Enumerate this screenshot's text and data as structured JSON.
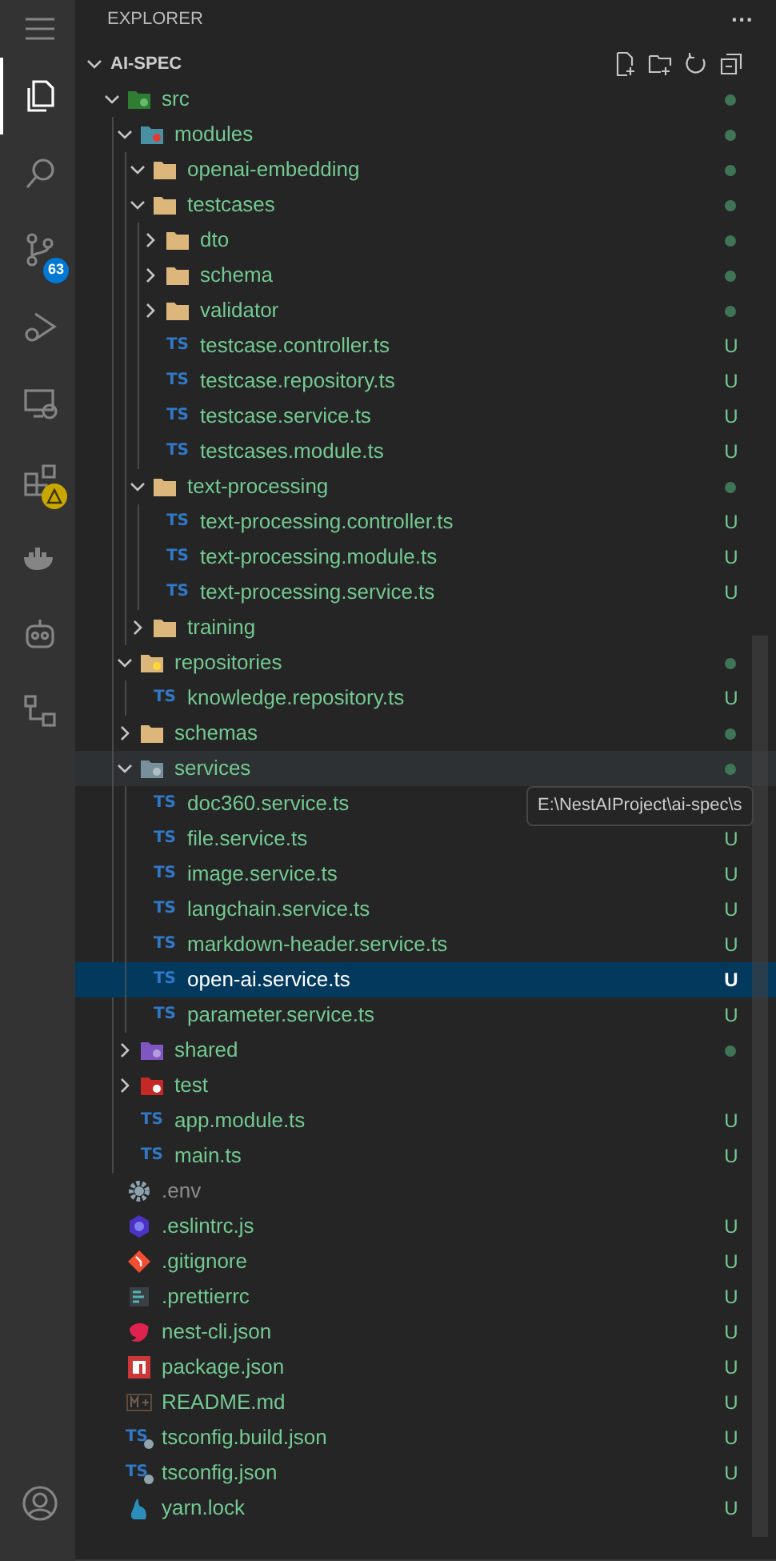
{
  "activity_bar": [
    {
      "kind": "menu",
      "selected": false
    },
    {
      "kind": "files",
      "selected": true
    },
    {
      "kind": "search",
      "selected": false
    },
    {
      "kind": "source-control",
      "selected": false,
      "badge": "63"
    },
    {
      "kind": "run-debug",
      "selected": false
    },
    {
      "kind": "remote",
      "selected": false
    },
    {
      "kind": "extensions",
      "selected": false,
      "warning": true
    },
    {
      "kind": "docker",
      "selected": false
    },
    {
      "kind": "robot",
      "selected": false
    },
    {
      "kind": "tree",
      "selected": false
    }
  ],
  "account": {
    "kind": "account"
  },
  "explorer": {
    "title": "EXPLORER",
    "more": "···",
    "section": {
      "title": "AI-SPEC",
      "expanded": true,
      "items": [
        {
          "name": "src",
          "kind": "folder-src",
          "expanded": true,
          "dot": true,
          "ignored": false,
          "selected": false,
          "hovered": false,
          "children": [
            {
              "name": "modules",
              "kind": "folder-modules",
              "expanded": true,
              "dot": true,
              "ignored": false,
              "selected": false,
              "hovered": false,
              "children": [
                {
                  "name": "openai-embedding",
                  "kind": "folder",
                  "expanded": true,
                  "dot": true,
                  "ignored": false,
                  "selected": false,
                  "hovered": false
                },
                {
                  "name": "testcases",
                  "kind": "folder",
                  "expanded": true,
                  "dot": true,
                  "ignored": false,
                  "selected": false,
                  "hovered": false,
                  "children": [
                    {
                      "name": "dto",
                      "kind": "folder",
                      "expanded": false,
                      "dot": true,
                      "ignored": false,
                      "selected": false,
                      "hovered": false
                    },
                    {
                      "name": "schema",
                      "kind": "folder",
                      "expanded": false,
                      "dot": true,
                      "ignored": false,
                      "selected": false,
                      "hovered": false
                    },
                    {
                      "name": "validator",
                      "kind": "folder",
                      "expanded": false,
                      "dot": true,
                      "ignored": false,
                      "selected": false,
                      "hovered": false
                    },
                    {
                      "name": "testcase.controller.ts",
                      "kind": "ts",
                      "icon_label": "TS",
                      "badge": "U",
                      "ignored": false,
                      "selected": false,
                      "hovered": false
                    },
                    {
                      "name": "testcase.repository.ts",
                      "kind": "ts",
                      "icon_label": "TS",
                      "badge": "U",
                      "ignored": false,
                      "selected": false,
                      "hovered": false
                    },
                    {
                      "name": "testcase.service.ts",
                      "kind": "ts",
                      "icon_label": "TS",
                      "badge": "U",
                      "ignored": false,
                      "selected": false,
                      "hovered": false
                    },
                    {
                      "name": "testcases.module.ts",
                      "kind": "ts",
                      "icon_label": "TS",
                      "badge": "U",
                      "ignored": false,
                      "selected": false,
                      "hovered": false
                    }
                  ]
                },
                {
                  "name": "text-processing",
                  "kind": "folder",
                  "expanded": true,
                  "dot": true,
                  "ignored": false,
                  "selected": false,
                  "hovered": false,
                  "children": [
                    {
                      "name": "text-processing.controller.ts",
                      "kind": "ts",
                      "icon_label": "TS",
                      "badge": "U",
                      "ignored": false,
                      "selected": false,
                      "hovered": false
                    },
                    {
                      "name": "text-processing.module.ts",
                      "kind": "ts",
                      "icon_label": "TS",
                      "badge": "U",
                      "ignored": false,
                      "selected": false,
                      "hovered": false
                    },
                    {
                      "name": "text-processing.service.ts",
                      "kind": "ts",
                      "icon_label": "TS",
                      "badge": "U",
                      "ignored": false,
                      "selected": false,
                      "hovered": false
                    }
                  ]
                },
                {
                  "name": "training",
                  "kind": "folder",
                  "expanded": false,
                  "dot": false,
                  "ignored": false,
                  "selected": false,
                  "hovered": false
                }
              ]
            },
            {
              "name": "repositories",
              "kind": "folder-repo",
              "expanded": true,
              "dot": true,
              "ignored": false,
              "selected": false,
              "hovered": false,
              "children": [
                {
                  "name": "knowledge.repository.ts",
                  "kind": "ts",
                  "icon_label": "TS",
                  "badge": "U",
                  "ignored": false,
                  "selected": false,
                  "hovered": false
                }
              ]
            },
            {
              "name": "schemas",
              "kind": "folder",
              "expanded": false,
              "dot": true,
              "ignored": false,
              "selected": false,
              "hovered": false
            },
            {
              "name": "services",
              "kind": "folder-services",
              "expanded": true,
              "dot": true,
              "ignored": false,
              "selected": false,
              "hovered": true,
              "children": [
                {
                  "name": "doc360.service.ts",
                  "kind": "ts",
                  "icon_label": "TS",
                  "ignored": false,
                  "selected": false,
                  "hovered": false
                },
                {
                  "name": "file.service.ts",
                  "kind": "ts",
                  "icon_label": "TS",
                  "badge": "U",
                  "ignored": false,
                  "selected": false,
                  "hovered": false
                },
                {
                  "name": "image.service.ts",
                  "kind": "ts",
                  "icon_label": "TS",
                  "badge": "U",
                  "ignored": false,
                  "selected": false,
                  "hovered": false
                },
                {
                  "name": "langchain.service.ts",
                  "kind": "ts",
                  "icon_label": "TS",
                  "badge": "U",
                  "ignored": false,
                  "selected": false,
                  "hovered": false
                },
                {
                  "name": "markdown-header.service.ts",
                  "kind": "ts",
                  "icon_label": "TS",
                  "badge": "U",
                  "ignored": false,
                  "selected": false,
                  "hovered": false
                },
                {
                  "name": "open-ai.service.ts",
                  "kind": "ts",
                  "icon_label": "TS",
                  "badge": "U",
                  "ignored": false,
                  "selected": true,
                  "hovered": false
                },
                {
                  "name": "parameter.service.ts",
                  "kind": "ts",
                  "icon_label": "TS",
                  "badge": "U",
                  "ignored": false,
                  "selected": false,
                  "hovered": false
                }
              ]
            },
            {
              "name": "shared",
              "kind": "folder-shared",
              "expanded": false,
              "dot": true,
              "ignored": false,
              "selected": false,
              "hovered": false
            },
            {
              "name": "test",
              "kind": "folder-test",
              "expanded": false,
              "dot": false,
              "ignored": false,
              "selected": false,
              "hovered": false
            },
            {
              "name": "app.module.ts",
              "kind": "ts",
              "icon_label": "TS",
              "badge": "U",
              "ignored": false,
              "selected": false,
              "hovered": false
            },
            {
              "name": "main.ts",
              "kind": "ts",
              "icon_label": "TS",
              "badge": "U",
              "ignored": false,
              "selected": false,
              "hovered": false
            }
          ]
        },
        {
          "name": ".env",
          "kind": "gear",
          "ignored": true,
          "selected": false,
          "hovered": false
        },
        {
          "name": ".eslintrc.js",
          "kind": "eslint",
          "badge": "U",
          "ignored": false,
          "selected": false,
          "hovered": false
        },
        {
          "name": ".gitignore",
          "kind": "git",
          "badge": "U",
          "ignored": false,
          "selected": false,
          "hovered": false
        },
        {
          "name": ".prettierrc",
          "kind": "prettier",
          "badge": "U",
          "ignored": false,
          "selected": false,
          "hovered": false
        },
        {
          "name": "nest-cli.json",
          "kind": "nest",
          "badge": "U",
          "ignored": false,
          "selected": false,
          "hovered": false
        },
        {
          "name": "package.json",
          "kind": "npm",
          "badge": "U",
          "ignored": false,
          "selected": false,
          "hovered": false
        },
        {
          "name": "README.md",
          "kind": "markdown",
          "badge": "U",
          "ignored": false,
          "selected": false,
          "hovered": false
        },
        {
          "name": "tsconfig.build.json",
          "kind": "tsconfig",
          "icon_label": "TS",
          "badge": "U",
          "ignored": false,
          "selected": false,
          "hovered": false
        },
        {
          "name": "tsconfig.json",
          "kind": "tsconfig",
          "icon_label": "TS",
          "badge": "U",
          "ignored": false,
          "selected": false,
          "hovered": false
        },
        {
          "name": "yarn.lock",
          "kind": "yarn",
          "badge": "U",
          "ignored": false,
          "selected": false,
          "hovered": false
        }
      ]
    }
  },
  "tooltip": {
    "text": "E:\\NestAIProject\\ai-spec\\s"
  }
}
